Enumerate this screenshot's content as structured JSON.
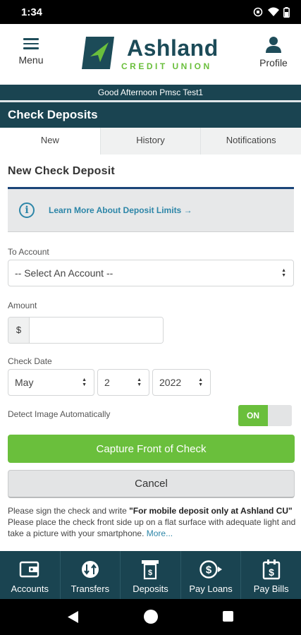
{
  "status_bar": {
    "time": "1:34"
  },
  "header": {
    "menu_label": "Menu",
    "profile_label": "Profile",
    "logo_name": "Ashland",
    "logo_sub": "CREDIT UNION"
  },
  "greeting": "Good Afternoon Pmsc Test1",
  "section_title": "Check Deposits",
  "tabs": [
    {
      "label": "New",
      "active": true
    },
    {
      "label": "History",
      "active": false
    },
    {
      "label": "Notifications",
      "active": false
    }
  ],
  "form": {
    "heading": "New Check Deposit",
    "info_link": "Learn More About Deposit Limits →",
    "to_account_label": "To Account",
    "to_account_value": "-- Select An Account --",
    "amount_label": "Amount",
    "amount_prefix": "$",
    "amount_value": "",
    "check_date_label": "Check Date",
    "month": "May",
    "day": "2",
    "year": "2022",
    "detect_label": "Detect Image Automatically",
    "detect_toggle": "ON",
    "capture_button": "Capture Front of Check",
    "cancel_button": "Cancel",
    "instructions_1_prefix": "Please sign the check and write ",
    "instructions_1_bold": "\"For mobile deposit only at Ashland CU\"",
    "instructions_2": "Please place the check front side up on a flat surface with adequate light and take a picture with your smartphone. ",
    "more_link": "More..."
  },
  "bottom_nav": [
    {
      "label": "Accounts",
      "icon": "wallet-icon"
    },
    {
      "label": "Transfers",
      "icon": "transfer-icon"
    },
    {
      "label": "Deposits",
      "icon": "deposit-icon"
    },
    {
      "label": "Pay Loans",
      "icon": "pay-loans-icon"
    },
    {
      "label": "Pay Bills",
      "icon": "pay-bills-icon"
    }
  ],
  "colors": {
    "brand_dark": "#1a4451",
    "brand_green": "#6abf3c",
    "link_blue": "#2d86a8",
    "info_border": "#1a4478"
  }
}
